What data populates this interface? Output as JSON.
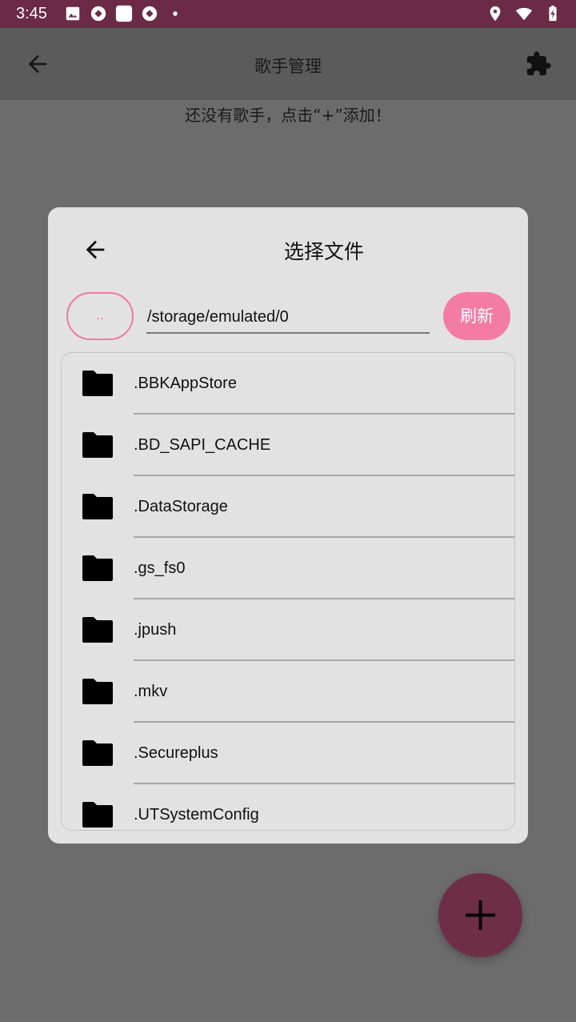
{
  "status_bar": {
    "time": "3:45",
    "left_icons": [
      "image-icon",
      "sync-icon",
      "square-icon",
      "sync-icon",
      "dot-icon"
    ],
    "right_icons": [
      "location-icon",
      "wifi-icon",
      "battery-charging-icon"
    ]
  },
  "app_bar": {
    "title": "歌手管理",
    "back_icon": "arrow-left-icon",
    "action_icon": "puzzle-icon"
  },
  "empty_hint": "还没有歌手，点击“+”添加！",
  "dialog": {
    "title": "选择文件",
    "up_label": "..",
    "path_value": "/storage/emulated/0",
    "refresh_label": "刷新",
    "files": [
      {
        "name": ".BBKAppStore"
      },
      {
        "name": ".BD_SAPI_CACHE"
      },
      {
        "name": ".DataStorage"
      },
      {
        "name": ".gs_fs0"
      },
      {
        "name": ".jpush"
      },
      {
        "name": ".mkv"
      },
      {
        "name": ".Secureplus"
      },
      {
        "name": ".UTSystemConfig"
      }
    ]
  },
  "fab": {
    "icon": "plus-icon"
  },
  "colors": {
    "status_bar": "#6b2a46",
    "accent": "#f47ba3",
    "fab": "#6e2e48",
    "dialog_bg": "#e2e2e2"
  }
}
